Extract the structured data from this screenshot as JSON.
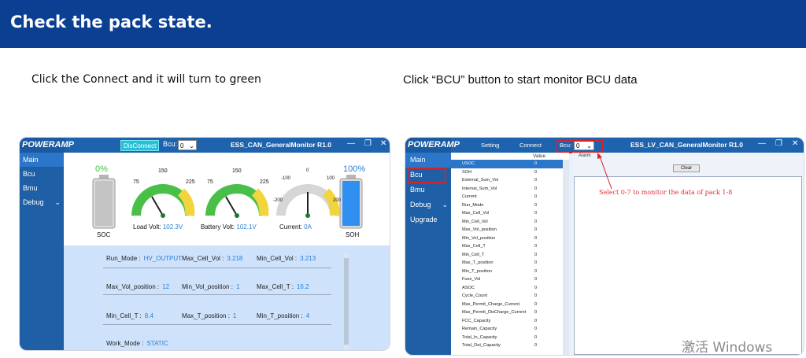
{
  "banner": {
    "title": "Check the pack state."
  },
  "instructions": {
    "left": "Click the Connect and it will turn to green",
    "right": "Click “BCU” button to start monitor BCU data"
  },
  "left_window": {
    "logo": "POWERAMP",
    "disconnect_label": "DisConnect",
    "bcu_label": "Bcu:",
    "bcu_value": "0",
    "title": "ESS_CAN_GeneralMonitor R1.0",
    "sidebar": [
      "Main",
      "Bcu",
      "Bmu",
      "Debug"
    ],
    "soc": {
      "percent_text": "0%",
      "label": "SOC",
      "level": 0
    },
    "soh": {
      "percent_text": "100%",
      "label": "SOH",
      "level": 1
    },
    "gauges": [
      {
        "label": "Load Volt:",
        "value": "102.3V",
        "ticks": [
          "75",
          "150",
          "225"
        ]
      },
      {
        "label": "Battery Volt:",
        "value": "102.1V",
        "ticks": [
          "75",
          "150",
          "225"
        ]
      },
      {
        "label": "Current:",
        "value": "0A",
        "ticks": [
          "-200",
          "-100",
          "0",
          "100",
          "200"
        ]
      }
    ],
    "info": {
      "run_mode_label": "Run_Mode :",
      "run_mode_value": "HV_OUTPUT",
      "max_cell_vol_label": "Max_Cell_Vol :",
      "max_cell_vol_value": "3.218",
      "min_cell_vol_label": "Min_Cell_Vol :",
      "min_cell_vol_value": "3.213",
      "max_vol_pos_label": "Max_Vol_position :",
      "max_vol_pos_value": "12",
      "min_vol_pos_label": "Min_Vol_position :",
      "min_vol_pos_value": "1",
      "max_cell_t_label": "Max_Cell_T :",
      "max_cell_t_value": "16.2",
      "min_cell_t_label": "Min_Cell_T :",
      "min_cell_t_value": "8.4",
      "max_t_pos_label": "Max_T_position :",
      "max_t_pos_value": "1",
      "min_t_pos_label": "Min_T_position :",
      "min_t_pos_value": "4",
      "work_mode_label": "Work_Mode :",
      "work_mode_value": "STATIC"
    }
  },
  "right_window": {
    "logo": "POWERAMP",
    "setting_label": "Setting",
    "connect_label": "Connect",
    "bcu_label": "Bcu:",
    "bcu_value": "0",
    "title": "ESS_LV_CAN_GeneralMonitor R1.0",
    "alarm_label": "Alarm",
    "clear_label": "Clear",
    "sidebar": [
      "Main",
      "Bcu",
      "Bmu",
      "Debug",
      "Upgrade"
    ],
    "table_header": "Value",
    "rows": [
      {
        "name": "USOC",
        "value": "0"
      },
      {
        "name": "SOH",
        "value": "0"
      },
      {
        "name": "External_Sum_Vol",
        "value": "0"
      },
      {
        "name": "Internal_Sum_Vol",
        "value": "0"
      },
      {
        "name": "Current",
        "value": "0"
      },
      {
        "name": "Run_Mode",
        "value": "0"
      },
      {
        "name": "Max_Cell_Vol",
        "value": "0"
      },
      {
        "name": "Min_Cell_Vol",
        "value": "0"
      },
      {
        "name": "Max_Vol_position",
        "value": "0"
      },
      {
        "name": "Min_Vol_position",
        "value": "0"
      },
      {
        "name": "Max_Cell_T",
        "value": "0"
      },
      {
        "name": "Min_Cell_T",
        "value": "0"
      },
      {
        "name": "Max_T_position",
        "value": "0"
      },
      {
        "name": "Min_T_position",
        "value": "0"
      },
      {
        "name": "Fuse_Vol",
        "value": "0"
      },
      {
        "name": "ASOC",
        "value": "0"
      },
      {
        "name": "Cycle_Count",
        "value": "0"
      },
      {
        "name": "Max_Permit_Charge_Current",
        "value": "0"
      },
      {
        "name": "Max_Permit_DisCharge_Current",
        "value": "0"
      },
      {
        "name": "FCC_Capacity",
        "value": "0"
      },
      {
        "name": "Remain_Capacity",
        "value": "0"
      },
      {
        "name": "Total_In_Capacity",
        "value": "0"
      },
      {
        "name": "Total_Out_Capacity",
        "value": "0"
      }
    ],
    "annotation": "Select 0-7 to monitor the data of pack 1-8"
  },
  "os_watermark": "激活 Windows"
}
